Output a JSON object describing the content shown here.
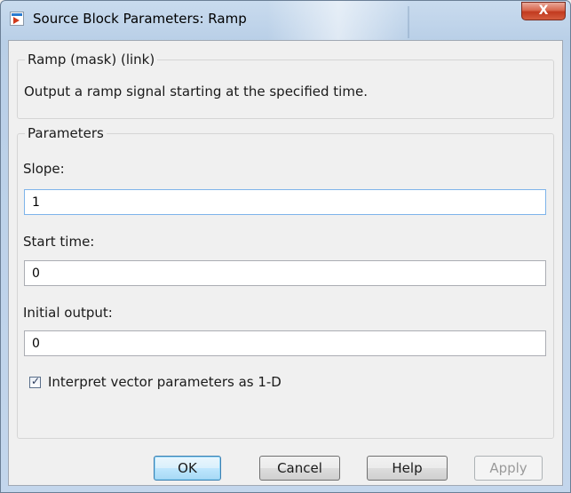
{
  "window": {
    "title": "Source Block Parameters: Ramp",
    "close_glyph": "X"
  },
  "mask": {
    "group_title": "Ramp (mask) (link)",
    "description": "Output a ramp signal starting at the specified time."
  },
  "parameters": {
    "group_title": "Parameters",
    "slope": {
      "label": "Slope:",
      "value": "1"
    },
    "start_time": {
      "label": "Start time:",
      "value": "0"
    },
    "initial_output": {
      "label": "Initial output:",
      "value": "0"
    },
    "interpret_vector": {
      "label": "Interpret vector parameters as 1-D",
      "checked": true,
      "check_glyph": "✓"
    }
  },
  "buttons": {
    "ok": "OK",
    "cancel": "Cancel",
    "help": "Help",
    "apply": "Apply"
  },
  "icons": [
    "simulink-block-icon",
    "close-icon",
    "checkbox-icon"
  ],
  "colors": {
    "titlebar": "#c3d6ec",
    "close": "#c23a1f",
    "default_button": "#3c7fb1"
  }
}
